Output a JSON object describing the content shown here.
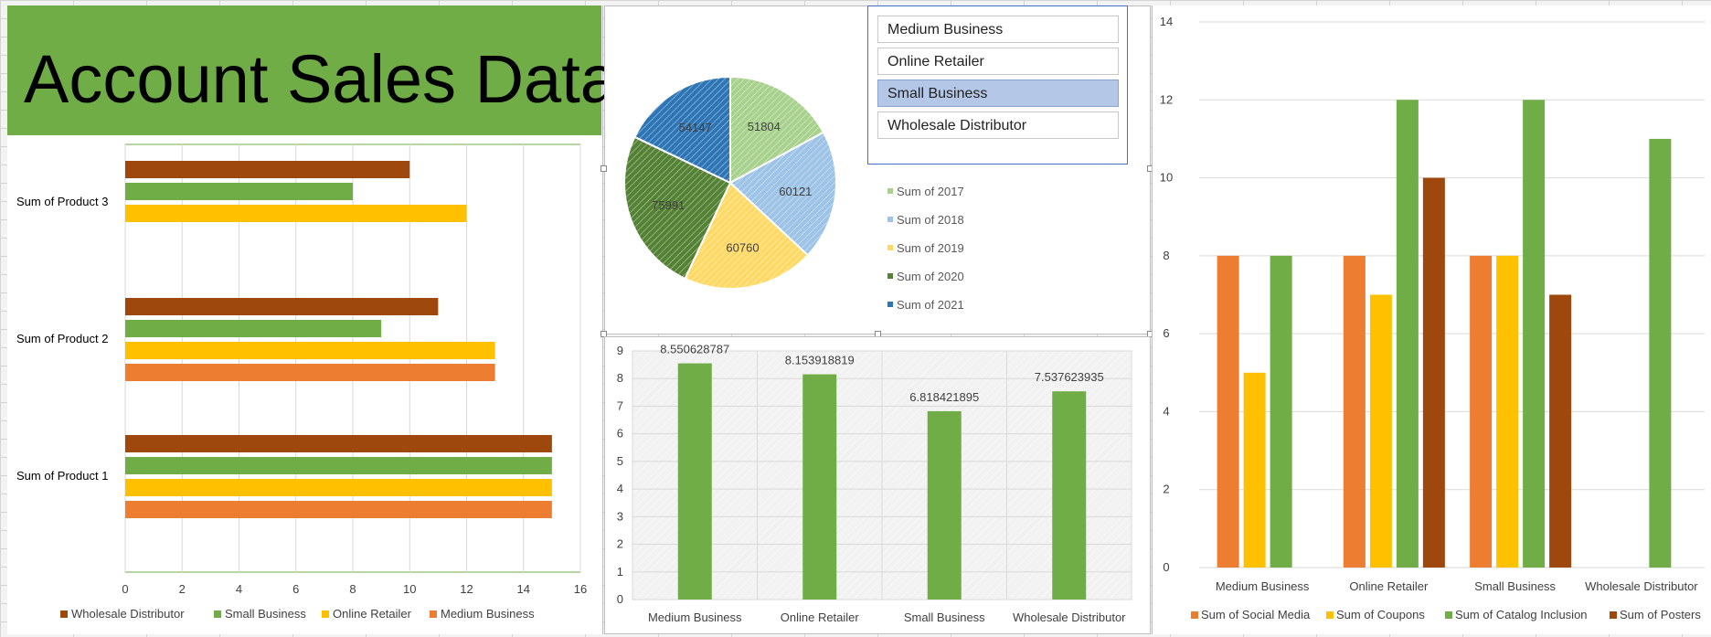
{
  "title": "Account Sales Data",
  "slicer": {
    "items": [
      "Medium Business",
      "Online Retailer",
      "Small Business",
      "Wholesale Distributor"
    ],
    "selected": "Small Business"
  },
  "chart_data": [
    {
      "id": "products",
      "type": "bar",
      "orientation": "horizontal",
      "categories": [
        "Sum of Product 1",
        "Sum of Product 2",
        "Sum of Product 3"
      ],
      "series": [
        {
          "name": "Medium Business",
          "color": "#ed7d31",
          "values": [
            15,
            13,
            null
          ]
        },
        {
          "name": "Online Retailer",
          "color": "#ffc000",
          "values": [
            15,
            13,
            12
          ]
        },
        {
          "name": "Small Business",
          "color": "#70ad47",
          "values": [
            15,
            9,
            8
          ]
        },
        {
          "name": "Wholesale Distributor",
          "color": "#9e480e",
          "values": [
            15,
            11,
            10
          ]
        }
      ],
      "xlim": [
        0,
        16
      ],
      "xticks": [
        "0",
        "2",
        "4",
        "6",
        "8",
        "10",
        "12",
        "14",
        "16"
      ],
      "legend_order": [
        "Wholesale Distributor",
        "Small Business",
        "Online Retailer",
        "Medium Business"
      ],
      "legend": "bottom",
      "grid": true
    },
    {
      "id": "years",
      "type": "pie",
      "labels": [
        "Sum of 2017",
        "Sum of 2018",
        "Sum of 2019",
        "Sum of 2020",
        "Sum of 2021"
      ],
      "values": [
        51804,
        60121,
        60760,
        75991,
        54147
      ],
      "value_labels": [
        "51804",
        "60121",
        "60760",
        "75991",
        "54147"
      ],
      "colors": [
        "#a9d18e",
        "#9dc3e6",
        "#ffd966",
        "#548235",
        "#2e75b6"
      ],
      "legend": "right"
    },
    {
      "id": "averages",
      "type": "bar",
      "categories": [
        "Medium Business",
        "Online Retailer",
        "Small Business",
        "Wholesale Distributor"
      ],
      "values": [
        8.550628787,
        8.153918819,
        6.818421895,
        7.537623935
      ],
      "value_labels": [
        "8.550628787",
        "8.153918819",
        "6.818421895",
        "7.537623935"
      ],
      "color": "#70ad47",
      "ylim": [
        0,
        9
      ],
      "yticks": [
        "0",
        "1",
        "2",
        "3",
        "4",
        "5",
        "6",
        "7",
        "8",
        "9"
      ],
      "grid": true
    },
    {
      "id": "marketing",
      "type": "bar",
      "categories": [
        "Medium Business",
        "Online Retailer",
        "Small Business",
        "Wholesale Distributor"
      ],
      "series": [
        {
          "name": "Sum of Social Media",
          "color": "#ed7d31",
          "values": [
            8,
            8,
            8,
            null
          ]
        },
        {
          "name": "Sum of Coupons",
          "color": "#ffc000",
          "values": [
            5,
            7,
            8,
            null
          ]
        },
        {
          "name": "Sum of Catalog Inclusion",
          "color": "#70ad47",
          "values": [
            8,
            12,
            12,
            11
          ]
        },
        {
          "name": "Sum of Posters",
          "color": "#9e480e",
          "values": [
            null,
            10,
            7,
            null
          ]
        }
      ],
      "ylim": [
        0,
        14
      ],
      "yticks": [
        "0",
        "2",
        "4",
        "6",
        "8",
        "10",
        "12",
        "14"
      ],
      "legend": "bottom",
      "grid": true
    }
  ]
}
